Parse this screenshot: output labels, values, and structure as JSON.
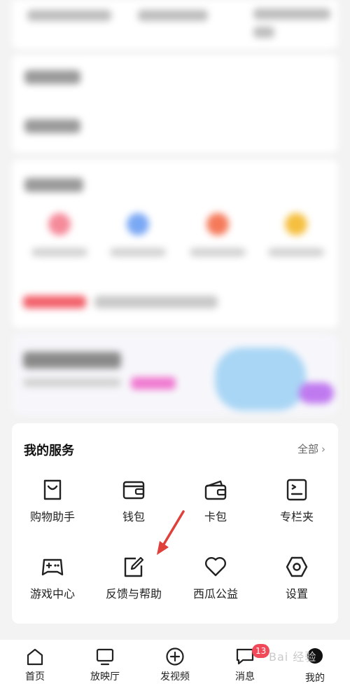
{
  "services": {
    "title": "我的服务",
    "all_label": "全部",
    "items": [
      {
        "label": "购物助手",
        "icon": "shopping-bag-icon"
      },
      {
        "label": "钱包",
        "icon": "wallet-icon"
      },
      {
        "label": "卡包",
        "icon": "card-holder-icon"
      },
      {
        "label": "专栏夹",
        "icon": "column-folder-icon"
      },
      {
        "label": "游戏中心",
        "icon": "gamepad-icon"
      },
      {
        "label": "反馈与帮助",
        "icon": "feedback-edit-icon"
      },
      {
        "label": "西瓜公益",
        "icon": "heart-icon"
      },
      {
        "label": "设置",
        "icon": "settings-hexagon-icon"
      }
    ]
  },
  "bottom_nav": {
    "items": [
      {
        "label": "首页",
        "icon": "home-icon"
      },
      {
        "label": "放映厅",
        "icon": "tv-icon"
      },
      {
        "label": "发视频",
        "icon": "add-circle-icon"
      },
      {
        "label": "消息",
        "icon": "message-icon",
        "badge": "13"
      },
      {
        "label": "我的",
        "icon": "avatar-icon"
      }
    ]
  },
  "watermark": "Bai 经验",
  "colors": {
    "badge": "#f04a5a",
    "arrow": "#e0403a"
  }
}
